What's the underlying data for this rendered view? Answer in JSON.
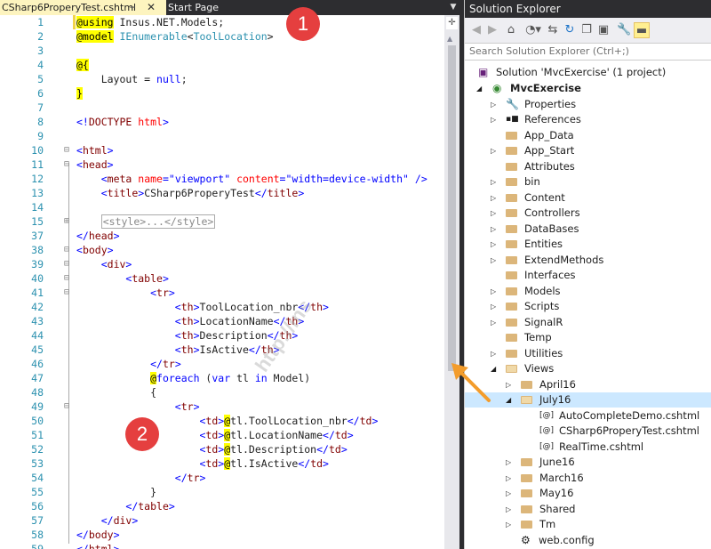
{
  "editor": {
    "active_tab": "CSharp6ProperyTest.cshtml",
    "active_tab_pin": "⫧",
    "active_tab_close": "✕",
    "inactive_tab": "Start Page",
    "dropdown_glyph": "▼"
  },
  "lines": [
    {
      "n": "1"
    },
    {
      "n": "2"
    },
    {
      "n": "3"
    },
    {
      "n": "4"
    },
    {
      "n": "5"
    },
    {
      "n": "6"
    },
    {
      "n": "7"
    },
    {
      "n": "8"
    },
    {
      "n": "9"
    },
    {
      "n": "10"
    },
    {
      "n": "11"
    },
    {
      "n": "12"
    },
    {
      "n": "13"
    },
    {
      "n": "14"
    },
    {
      "n": "15"
    },
    {
      "n": "37"
    },
    {
      "n": "38"
    },
    {
      "n": "39"
    },
    {
      "n": "40"
    },
    {
      "n": "41"
    },
    {
      "n": "42"
    },
    {
      "n": "43"
    },
    {
      "n": "44"
    },
    {
      "n": "45"
    },
    {
      "n": "46"
    },
    {
      "n": "47"
    },
    {
      "n": "48"
    },
    {
      "n": "49"
    },
    {
      "n": "50"
    },
    {
      "n": "51"
    },
    {
      "n": "52"
    },
    {
      "n": "53"
    },
    {
      "n": "54"
    },
    {
      "n": "55"
    },
    {
      "n": "56"
    },
    {
      "n": "57"
    },
    {
      "n": "58"
    },
    {
      "n": "59"
    }
  ],
  "code": {
    "l1_at": "@using",
    "l1_rest": " Insus.NET.Models;",
    "l2_at": "@model",
    "l2_type": " IEnumerable",
    "l2_lt": "<",
    "l2_arg": "ToolLocation",
    "l2_gt": ">",
    "l4": "@{",
    "l5_a": "    Layout = ",
    "l5_kw": "null",
    "l5_b": ";",
    "l6": "}",
    "l8_open": "<!",
    "l8_tag": "DOCTYPE",
    "l8_attr": " html",
    "l8_close": ">",
    "l10_open": "<",
    "l10_tag": "html",
    "l10_close": ">",
    "l11_open": "<",
    "l11_tag": "head",
    "l11_close": ">",
    "l12_indent": "    ",
    "l12_open": "<",
    "l12_tag": "meta",
    "l12_a1": " name",
    "l12_eq1": "=",
    "l12_v1": "\"viewport\"",
    "l12_a2": " content",
    "l12_eq2": "=",
    "l12_v2": "\"width=device-width\"",
    "l12_close": " />",
    "l13_indent": "    ",
    "l13_open": "<",
    "l13_tag": "title",
    "l13_close": ">",
    "l13_text": "CSharp6ProperyTest",
    "l13_end_open": "</",
    "l13_end_tag": "title",
    "l13_end_close": ">",
    "l15_indent": "    ",
    "l15_collapsed": "<style>...</style>",
    "l37_open": "</",
    "l37_tag": "head",
    "l37_close": ">",
    "l38_open": "<",
    "l38_tag": "body",
    "l38_close": ">",
    "l39_indent": "    ",
    "l39_open": "<",
    "l39_tag": "div",
    "l39_close": ">",
    "l40_indent": "        ",
    "l40_open": "<",
    "l40_tag": "table",
    "l40_close": ">",
    "l41_indent": "            ",
    "l41_open": "<",
    "l41_tag": "tr",
    "l41_close": ">",
    "th": [
      "ToolLocation_nbr",
      "LocationName",
      "Description",
      "IsActive"
    ],
    "th_tag": "th",
    "l46_indent": "            ",
    "l46_open": "</",
    "l46_tag": "tr",
    "l46_close": ">",
    "l47_indent": "            ",
    "l47_at": "@",
    "l47_kw": "foreach",
    "l47_a": " (",
    "l47_kw2": "var",
    "l47_b": " tl ",
    "l47_kw3": "in",
    "l47_c": " ",
    "l47_model": "Model",
    "l47_d": ")",
    "l48_indent": "            ",
    "l48": "{",
    "l49_indent": "                ",
    "l49_open": "<",
    "l49_tag": "tr",
    "l49_close": ">",
    "td": [
      "tl.ToolLocation_nbr",
      "tl.LocationName",
      "tl.Description",
      "tl.IsActive"
    ],
    "td_tag": "td",
    "td_at": "@",
    "l54_indent": "                ",
    "l54_open": "</",
    "l54_tag": "tr",
    "l54_close": ">",
    "l55_indent": "            ",
    "l55": "}",
    "l56_indent": "        ",
    "l56_open": "</",
    "l56_tag": "table",
    "l56_close": ">",
    "l57_indent": "    ",
    "l57_open": "</",
    "l57_tag": "div",
    "l57_close": ">",
    "l58_open": "</",
    "l58_tag": "body",
    "l58_close": ">",
    "l59_open": "</",
    "l59_tag": "html",
    "l59_close": ">",
    "lt": "<",
    "lte": "</",
    "gt": ">"
  },
  "annotations": {
    "badge1": "1",
    "badge2": "2",
    "watermark": "http://ins"
  },
  "solution_explorer": {
    "title": "Solution Explorer",
    "search_placeholder": "Search Solution Explorer (Ctrl+;)",
    "solution": "Solution 'MvcExercise' (1 project)",
    "project": "MvcExercise",
    "items": [
      {
        "label": "Properties"
      },
      {
        "label": "References"
      },
      {
        "label": "App_Data"
      },
      {
        "label": "App_Start"
      },
      {
        "label": "Attributes"
      },
      {
        "label": "bin"
      },
      {
        "label": "Content"
      },
      {
        "label": "Controllers"
      },
      {
        "label": "DataBases"
      },
      {
        "label": "Entities"
      },
      {
        "label": "ExtendMethods"
      },
      {
        "label": "Interfaces"
      },
      {
        "label": "Models"
      },
      {
        "label": "Scripts"
      },
      {
        "label": "SignalR"
      },
      {
        "label": "Temp"
      },
      {
        "label": "Utilities"
      },
      {
        "label": "Views"
      },
      {
        "label": "April16"
      },
      {
        "label": "July16"
      },
      {
        "label": "AutoCompleteDemo.cshtml"
      },
      {
        "label": "CSharp6ProperyTest.cshtml"
      },
      {
        "label": "RealTime.cshtml"
      },
      {
        "label": "June16"
      },
      {
        "label": "March16"
      },
      {
        "label": "May16"
      },
      {
        "label": "Shared"
      },
      {
        "label": "Tm"
      },
      {
        "label": "web.config"
      }
    ],
    "file_badge": "[@]"
  },
  "colors": {
    "accent": "#ffef91",
    "badge": "#e53f3f",
    "arrow": "#f39c2b",
    "selected": "#cce8ff"
  }
}
